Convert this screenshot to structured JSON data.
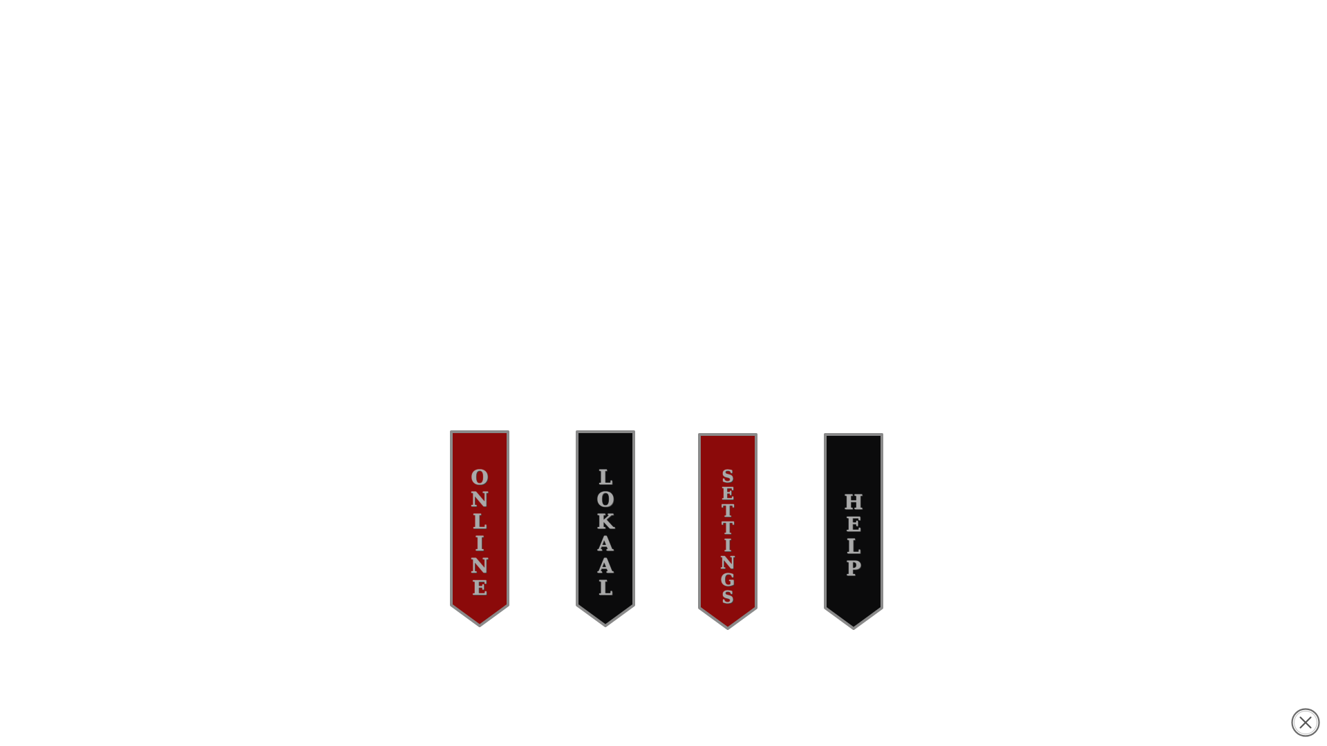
{
  "menu": {
    "banners": [
      {
        "id": "online",
        "label": "ONLINE",
        "color": "#8b0a0a"
      },
      {
        "id": "lokaal",
        "label": "LOKAAL",
        "color": "#0b0b0c"
      },
      {
        "id": "settings",
        "label": "SETTINGS",
        "color": "#8b0a0a"
      },
      {
        "id": "help",
        "label": "HELP",
        "color": "#0b0b0c"
      }
    ],
    "border_color": "#8a8a8a",
    "label_color": "#a9a9a9"
  },
  "close_icon": "close-icon"
}
